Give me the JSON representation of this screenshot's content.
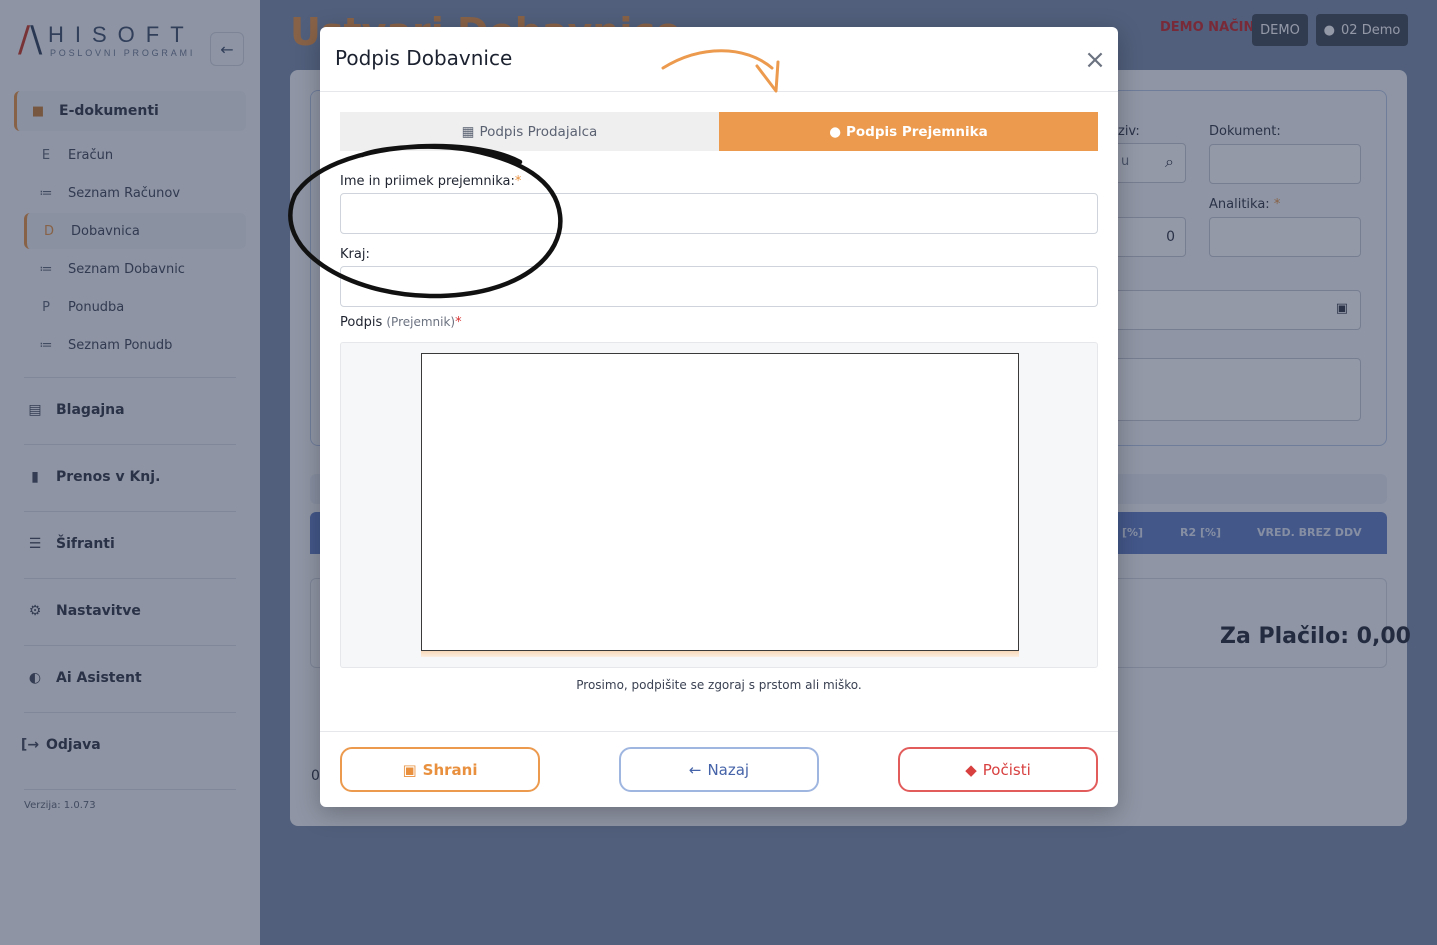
{
  "app": {
    "logo_letters": "HISOFT",
    "logo_sub": "POSLOVNI PROGRAMI",
    "page_title": "Ustvari Dobavnico",
    "demo_text": "DEMO NAČIN",
    "demo_button": "DEMO",
    "user_button": "02 Demo",
    "version": "Verzija: 1.0.73"
  },
  "sidebar": {
    "main": "E-dokumenti",
    "subitems": [
      {
        "icon": "E",
        "label": "Eračun"
      },
      {
        "icon": "≔",
        "label": "Seznam Računov"
      },
      {
        "icon": "D",
        "label": "Dobavnica"
      },
      {
        "icon": "≔",
        "label": "Seznam Dobavnic"
      },
      {
        "icon": "P",
        "label": "Ponudba"
      },
      {
        "icon": "≔",
        "label": "Seznam Ponudb"
      }
    ],
    "groups": [
      {
        "icon": "cash-register-icon",
        "label": "Blagajna"
      },
      {
        "icon": "book-icon",
        "label": "Prenos v Knj."
      },
      {
        "icon": "database-icon",
        "label": "Šifranti"
      },
      {
        "icon": "gear-icon",
        "label": "Nastavitve"
      },
      {
        "icon": "brain-icon",
        "label": "Ai Asistent"
      },
      {
        "icon": "logout-icon",
        "label": "Odjava"
      }
    ]
  },
  "background_form": {
    "naziv_label": "ziv:",
    "naziv_value": "u",
    "dokument_label": "Dokument:",
    "analitika_label": "Analitika:",
    "analitika_req": "*",
    "number_value": "0",
    "table_headers": [
      "[%]",
      "R2 [%]",
      "VRED. BREZ DDV"
    ],
    "za_placilo": "Za Plačilo: 0,00",
    "left_zero": "0"
  },
  "modal": {
    "title": "Podpis Dobavnice",
    "tabs": {
      "seller": "Podpis Prodajalca",
      "receiver": "Podpis Prejemnika"
    },
    "fields": {
      "name_label": "Ime in priimek prejemnika:",
      "name_value": "",
      "place_label": "Kraj:",
      "place_value": "",
      "signature_label": "Podpis",
      "signature_sub": "(Prejemnik)"
    },
    "hint": "Prosimo, podpišite se zgoraj s prstom ali miško.",
    "buttons": {
      "save": "Shrani",
      "back": "Nazaj",
      "clear": "Počisti"
    }
  },
  "colors": {
    "accent": "#ec9a4d",
    "danger": "#d84040",
    "primary": "#4563a8",
    "sidebar_bg": "#f4f4f6"
  }
}
